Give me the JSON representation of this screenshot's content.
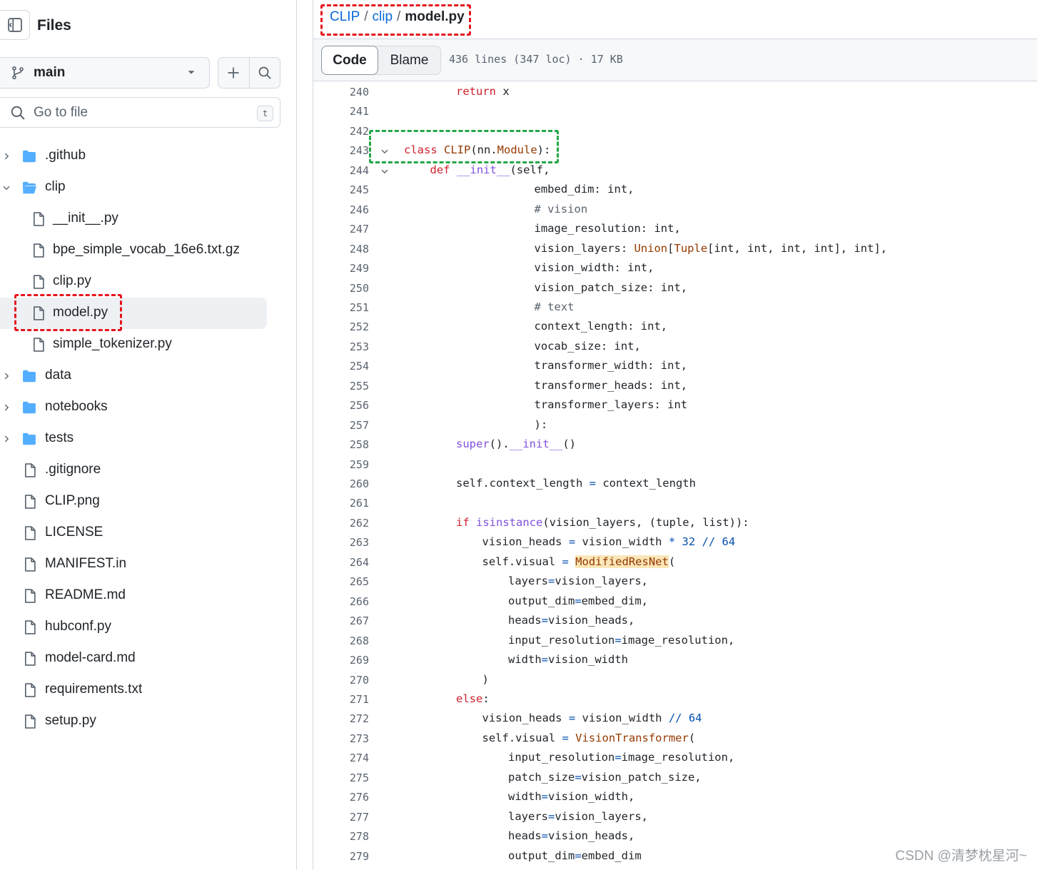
{
  "sidebar": {
    "title": "Files",
    "branch": "main",
    "goto_placeholder": "Go to file",
    "goto_shortcut": "t",
    "tree": [
      {
        "label": ".github",
        "type": "folder",
        "expanded": false,
        "depth": 0
      },
      {
        "label": "clip",
        "type": "folder",
        "expanded": true,
        "depth": 0
      },
      {
        "label": "__init__.py",
        "type": "file",
        "depth": 1
      },
      {
        "label": "bpe_simple_vocab_16e6.txt.gz",
        "type": "file",
        "depth": 1
      },
      {
        "label": "clip.py",
        "type": "file",
        "depth": 1
      },
      {
        "label": "model.py",
        "type": "file",
        "depth": 1,
        "selected": true
      },
      {
        "label": "simple_tokenizer.py",
        "type": "file",
        "depth": 1
      },
      {
        "label": "data",
        "type": "folder",
        "expanded": false,
        "depth": 0
      },
      {
        "label": "notebooks",
        "type": "folder",
        "expanded": false,
        "depth": 0
      },
      {
        "label": "tests",
        "type": "folder",
        "expanded": false,
        "depth": 0
      },
      {
        "label": ".gitignore",
        "type": "file",
        "depth": 0
      },
      {
        "label": "CLIP.png",
        "type": "file",
        "depth": 0
      },
      {
        "label": "LICENSE",
        "type": "file",
        "depth": 0
      },
      {
        "label": "MANIFEST.in",
        "type": "file",
        "depth": 0
      },
      {
        "label": "README.md",
        "type": "file",
        "depth": 0
      },
      {
        "label": "hubconf.py",
        "type": "file",
        "depth": 0
      },
      {
        "label": "model-card.md",
        "type": "file",
        "depth": 0
      },
      {
        "label": "requirements.txt",
        "type": "file",
        "depth": 0
      },
      {
        "label": "setup.py",
        "type": "file",
        "depth": 0
      }
    ]
  },
  "breadcrumb": {
    "repo": "CLIP",
    "folder": "clip",
    "file": "model.py",
    "sep": "/"
  },
  "toolbar": {
    "code_tab": "Code",
    "blame_tab": "Blame",
    "meta": "436 lines (347 loc) · 17 KB"
  },
  "code": {
    "lines": [
      {
        "n": "240",
        "indent": 2,
        "tokens": [
          [
            "kw",
            "return"
          ],
          [
            "",
            " x"
          ]
        ]
      },
      {
        "n": "241",
        "indent": 0,
        "tokens": []
      },
      {
        "n": "242",
        "indent": 0,
        "tokens": []
      },
      {
        "n": "243",
        "indent": 0,
        "fold": true,
        "tokens": [
          [
            "kw",
            "class "
          ],
          [
            "cls",
            "CLIP"
          ],
          [
            "",
            "(nn."
          ],
          [
            "cls",
            "Module"
          ],
          [
            "",
            "):"
          ]
        ]
      },
      {
        "n": "244",
        "indent": 1,
        "fold": true,
        "tokens": [
          [
            "kw",
            "def "
          ],
          [
            "fn",
            "__init__"
          ],
          [
            "",
            "(self,"
          ]
        ]
      },
      {
        "n": "245",
        "indent": 5,
        "tokens": [
          [
            "",
            "embed_dim: int,"
          ]
        ]
      },
      {
        "n": "246",
        "indent": 5,
        "tokens": [
          [
            "cm",
            "# vision"
          ]
        ]
      },
      {
        "n": "247",
        "indent": 5,
        "tokens": [
          [
            "",
            "image_resolution: int,"
          ]
        ]
      },
      {
        "n": "248",
        "indent": 5,
        "tokens": [
          [
            "",
            "vision_layers: "
          ],
          [
            "cls",
            "Union"
          ],
          [
            "",
            "["
          ],
          [
            "cls",
            "Tuple"
          ],
          [
            "",
            "[int, int, int, int], int],"
          ]
        ]
      },
      {
        "n": "249",
        "indent": 5,
        "tokens": [
          [
            "",
            "vision_width: int,"
          ]
        ]
      },
      {
        "n": "250",
        "indent": 5,
        "tokens": [
          [
            "",
            "vision_patch_size: int,"
          ]
        ]
      },
      {
        "n": "251",
        "indent": 5,
        "tokens": [
          [
            "cm",
            "# text"
          ]
        ]
      },
      {
        "n": "252",
        "indent": 5,
        "tokens": [
          [
            "",
            "context_length: int,"
          ]
        ]
      },
      {
        "n": "253",
        "indent": 5,
        "tokens": [
          [
            "",
            "vocab_size: int,"
          ]
        ]
      },
      {
        "n": "254",
        "indent": 5,
        "tokens": [
          [
            "",
            "transformer_width: int,"
          ]
        ]
      },
      {
        "n": "255",
        "indent": 5,
        "tokens": [
          [
            "",
            "transformer_heads: int,"
          ]
        ]
      },
      {
        "n": "256",
        "indent": 5,
        "tokens": [
          [
            "",
            "transformer_layers: int"
          ]
        ]
      },
      {
        "n": "257",
        "indent": 5,
        "tokens": [
          [
            "",
            "):"
          ]
        ]
      },
      {
        "n": "258",
        "indent": 2,
        "tokens": [
          [
            "fn",
            "super"
          ],
          [
            "",
            "()."
          ],
          [
            "fn",
            "__init__"
          ],
          [
            "",
            "()"
          ]
        ]
      },
      {
        "n": "259",
        "indent": 0,
        "tokens": []
      },
      {
        "n": "260",
        "indent": 2,
        "tokens": [
          [
            "",
            "self.context_length "
          ],
          [
            "nm",
            "="
          ],
          [
            "",
            " context_length"
          ]
        ]
      },
      {
        "n": "261",
        "indent": 0,
        "tokens": []
      },
      {
        "n": "262",
        "indent": 2,
        "tokens": [
          [
            "kw",
            "if "
          ],
          [
            "fn",
            "isinstance"
          ],
          [
            "",
            "(vision_layers, (tuple, list)):"
          ]
        ]
      },
      {
        "n": "263",
        "indent": 3,
        "tokens": [
          [
            "",
            "vision_heads "
          ],
          [
            "nm",
            "="
          ],
          [
            "",
            " vision_width "
          ],
          [
            "nm",
            "* 32 // 64"
          ]
        ]
      },
      {
        "n": "264",
        "indent": 3,
        "tokens": [
          [
            "",
            "self.visual "
          ],
          [
            "nm",
            "="
          ],
          [
            "",
            " "
          ],
          [
            "cls hl",
            "ModifiedResNet"
          ],
          [
            "",
            "("
          ]
        ]
      },
      {
        "n": "265",
        "indent": 4,
        "tokens": [
          [
            "",
            "layers"
          ],
          [
            "nm",
            "="
          ],
          [
            "",
            "vision_layers,"
          ]
        ]
      },
      {
        "n": "266",
        "indent": 4,
        "tokens": [
          [
            "",
            "output_dim"
          ],
          [
            "nm",
            "="
          ],
          [
            "",
            "embed_dim,"
          ]
        ]
      },
      {
        "n": "267",
        "indent": 4,
        "tokens": [
          [
            "",
            "heads"
          ],
          [
            "nm",
            "="
          ],
          [
            "",
            "vision_heads,"
          ]
        ]
      },
      {
        "n": "268",
        "indent": 4,
        "tokens": [
          [
            "",
            "input_resolution"
          ],
          [
            "nm",
            "="
          ],
          [
            "",
            "image_resolution,"
          ]
        ]
      },
      {
        "n": "269",
        "indent": 4,
        "tokens": [
          [
            "",
            "width"
          ],
          [
            "nm",
            "="
          ],
          [
            "",
            "vision_width"
          ]
        ]
      },
      {
        "n": "270",
        "indent": 3,
        "tokens": [
          [
            "",
            ")"
          ]
        ]
      },
      {
        "n": "271",
        "indent": 2,
        "tokens": [
          [
            "kw",
            "else"
          ],
          [
            "",
            ":"
          ]
        ]
      },
      {
        "n": "272",
        "indent": 3,
        "tokens": [
          [
            "",
            "vision_heads "
          ],
          [
            "nm",
            "="
          ],
          [
            "",
            " vision_width "
          ],
          [
            "nm",
            "// 64"
          ]
        ]
      },
      {
        "n": "273",
        "indent": 3,
        "tokens": [
          [
            "",
            "self.visual "
          ],
          [
            "nm",
            "="
          ],
          [
            "",
            " "
          ],
          [
            "cls",
            "VisionTransformer"
          ],
          [
            "",
            "("
          ]
        ]
      },
      {
        "n": "274",
        "indent": 4,
        "tokens": [
          [
            "",
            "input_resolution"
          ],
          [
            "nm",
            "="
          ],
          [
            "",
            "image_resolution,"
          ]
        ]
      },
      {
        "n": "275",
        "indent": 4,
        "tokens": [
          [
            "",
            "patch_size"
          ],
          [
            "nm",
            "="
          ],
          [
            "",
            "vision_patch_size,"
          ]
        ]
      },
      {
        "n": "276",
        "indent": 4,
        "tokens": [
          [
            "",
            "width"
          ],
          [
            "nm",
            "="
          ],
          [
            "",
            "vision_width,"
          ]
        ]
      },
      {
        "n": "277",
        "indent": 4,
        "tokens": [
          [
            "",
            "layers"
          ],
          [
            "nm",
            "="
          ],
          [
            "",
            "vision_layers,"
          ]
        ]
      },
      {
        "n": "278",
        "indent": 4,
        "tokens": [
          [
            "",
            "heads"
          ],
          [
            "nm",
            "="
          ],
          [
            "",
            "vision_heads,"
          ]
        ]
      },
      {
        "n": "279",
        "indent": 4,
        "tokens": [
          [
            "",
            "output_dim"
          ],
          [
            "nm",
            "="
          ],
          [
            "",
            "embed_dim"
          ]
        ]
      }
    ]
  },
  "watermark": "CSDN @清梦枕星河~",
  "colors": {
    "accent": "#0969da",
    "annotation_red": "#e5151f",
    "annotation_green": "#22a845",
    "highlight": "#fae6b8"
  }
}
